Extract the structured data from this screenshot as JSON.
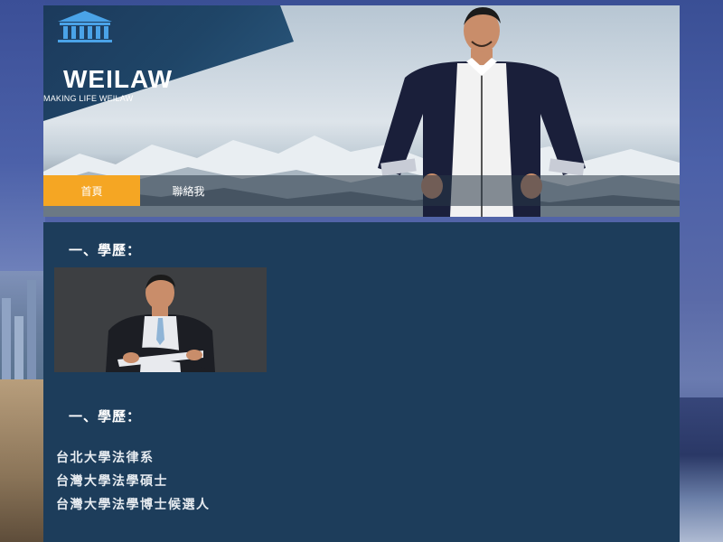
{
  "site": {
    "brand": "WEILAW",
    "slogan": "MAKING LIFE WEILAW"
  },
  "nav": {
    "items": [
      {
        "label": "首頁",
        "active": true
      },
      {
        "label": "聯絡我",
        "active": false
      }
    ]
  },
  "content": {
    "heading1": "一、學歷：",
    "heading2": "一、學歷：",
    "education": [
      "台北大學法律系",
      "台灣大學法學碩士",
      "台灣大學法學博士候選人"
    ]
  },
  "colors": {
    "accent": "#f5a623",
    "content_bg": "#1d3d5b",
    "logo_panel": "#1f4567"
  },
  "icons": [
    "courthouse-icon"
  ]
}
